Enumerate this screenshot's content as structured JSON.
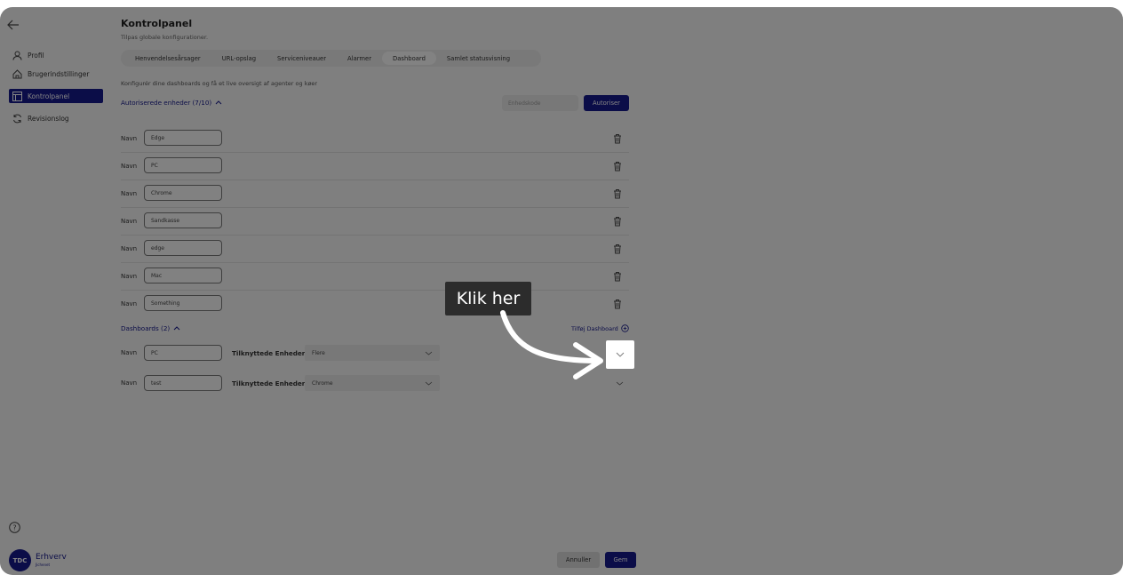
{
  "app": {
    "page_title": "Kontrolpanel",
    "page_subtitle": "Tilpas globale konfigurationer."
  },
  "sidebar": {
    "items": [
      {
        "label": "Profil",
        "icon": "user-icon"
      },
      {
        "label": "Brugerindstillinger",
        "icon": "home-icon"
      },
      {
        "label": "Kontrolpanel",
        "icon": "panel-icon",
        "active": true
      },
      {
        "label": "Revisionslog",
        "icon": "refresh-icon"
      }
    ],
    "logo_brand": "TDC",
    "logo_text": "Erhverv",
    "logo_sub": "Jichenet"
  },
  "tabs": [
    {
      "label": "Henvendelsesårsager"
    },
    {
      "label": "URL-opslag"
    },
    {
      "label": "Serviceniveauer"
    },
    {
      "label": "Alarmer"
    },
    {
      "label": "Dashboard",
      "active": true
    },
    {
      "label": "Samlet statusvisning"
    }
  ],
  "main": {
    "description": "Konfigurér dine dashboards og få et live oversigt af agenter og køer",
    "devices_header": "Autoriserede enheder (7/10)",
    "device_code_placeholder": "Enhedskode",
    "authorize_label": "Autoriser",
    "name_label": "Navn",
    "devices": [
      {
        "name": "Edge"
      },
      {
        "name": "PC"
      },
      {
        "name": "Chrome"
      },
      {
        "name": "Sandkasse"
      },
      {
        "name": "edge"
      },
      {
        "name": "Mac"
      },
      {
        "name": "Something"
      }
    ],
    "dashboards_header": "Dashboards (2)",
    "add_dashboard_label": "Tilføj Dashboard",
    "linked_devices_label": "Tilknyttede Enheder",
    "dashboards": [
      {
        "name": "PC",
        "linked": "Flere"
      },
      {
        "name": "test",
        "linked": "Chrome"
      }
    ]
  },
  "footer": {
    "cancel_label": "Annuller",
    "save_label": "Gem"
  },
  "tutorial": {
    "tooltip_text": "Klik her"
  },
  "colors": {
    "accent": "#16198a",
    "overlay": "rgba(0,0,0,0.48)"
  }
}
